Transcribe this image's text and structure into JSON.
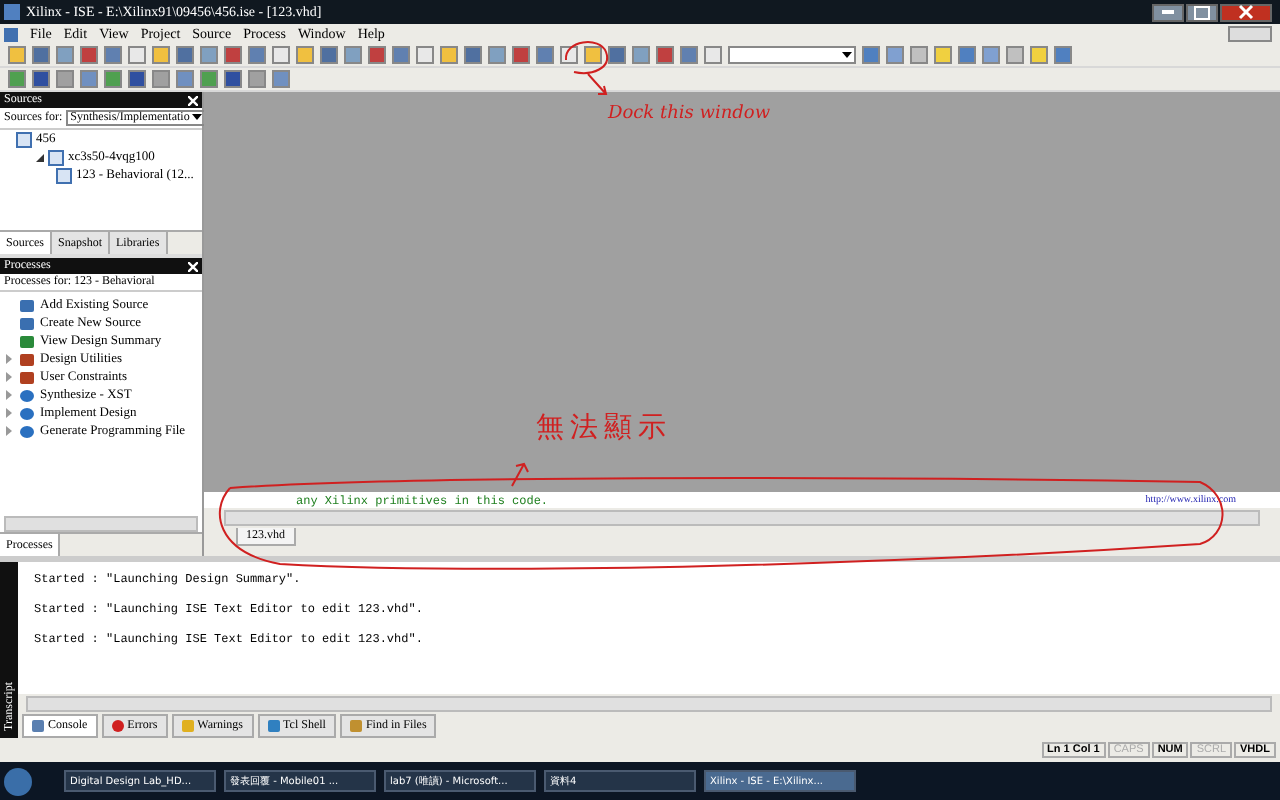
{
  "window": {
    "title": "Xilinx - ISE - E:\\Xilinx91\\09456\\456.ise - [123.vhd]"
  },
  "menu": [
    "File",
    "Edit",
    "View",
    "Project",
    "Source",
    "Process",
    "Window",
    "Help"
  ],
  "sources": {
    "title": "Sources",
    "for_label": "Sources for:",
    "for_value": "Synthesis/Implementatio",
    "tree": [
      {
        "label": "456",
        "children": [
          {
            "label": "xc3s50-4vqg100",
            "children": [
              {
                "label": "123 - Behavioral (12..."
              }
            ]
          }
        ]
      }
    ],
    "tabs": [
      {
        "label": "Sources",
        "selected": true
      },
      {
        "label": "Snapshot",
        "selected": false
      },
      {
        "label": "Libraries",
        "selected": false
      }
    ]
  },
  "processes": {
    "title": "Processes",
    "for_label": "Processes for: 123 - Behavioral",
    "items": [
      {
        "label": "Add Existing Source",
        "kind": "window"
      },
      {
        "label": "Create New Source",
        "kind": "window"
      },
      {
        "label": "View Design Summary",
        "kind": "summary"
      },
      {
        "label": "Design Utilities",
        "kind": "tools"
      },
      {
        "label": "User Constraints",
        "kind": "tools"
      },
      {
        "label": "Synthesize - XST",
        "kind": "run"
      },
      {
        "label": "Implement Design",
        "kind": "run"
      },
      {
        "label": "Generate Programming File",
        "kind": "run"
      }
    ],
    "tabs": [
      {
        "label": "Processes",
        "selected": true
      }
    ]
  },
  "editor": {
    "code_line": "any Xilinx primitives in this code.",
    "link": "http://www.xilinx.com",
    "tabs": [
      {
        "label": "123.vhd"
      }
    ]
  },
  "annotations": [
    {
      "text": "Dock this window"
    },
    {
      "text": "無法顯示"
    }
  ],
  "transcript": {
    "side_label": "Transcript",
    "lines": [
      "Started : \"Launching Design Summary\".",
      "Started : \"Launching ISE Text Editor to edit 123.vhd\".",
      "Started : \"Launching ISE Text Editor to edit 123.vhd\"."
    ],
    "tabs": [
      {
        "label": "Console",
        "kind": "console",
        "selected": true
      },
      {
        "label": "Errors",
        "kind": "error",
        "selected": false
      },
      {
        "label": "Warnings",
        "kind": "warning",
        "selected": false
      },
      {
        "label": "Tcl Shell",
        "kind": "tcl",
        "selected": false
      },
      {
        "label": "Find in Files",
        "kind": "find",
        "selected": false
      }
    ]
  },
  "status_bar": [
    {
      "label": "Ln 1 Col 1",
      "disabled": false
    },
    {
      "label": "CAPS",
      "disabled": true
    },
    {
      "label": "NUM",
      "disabled": false
    },
    {
      "label": "SCRL",
      "disabled": true
    },
    {
      "label": "VHDL",
      "disabled": false
    }
  ],
  "taskbar": [
    {
      "label": "Digital Design Lab_HD...",
      "selected": false
    },
    {
      "label": "發表回覆 - Mobile01 ...",
      "selected": false
    },
    {
      "label": "lab7 (唯讀) - Microsoft...",
      "selected": false
    },
    {
      "label": "資料4",
      "selected": false
    },
    {
      "label": "Xilinx - ISE - E:\\Xilinx...",
      "selected": true
    }
  ]
}
